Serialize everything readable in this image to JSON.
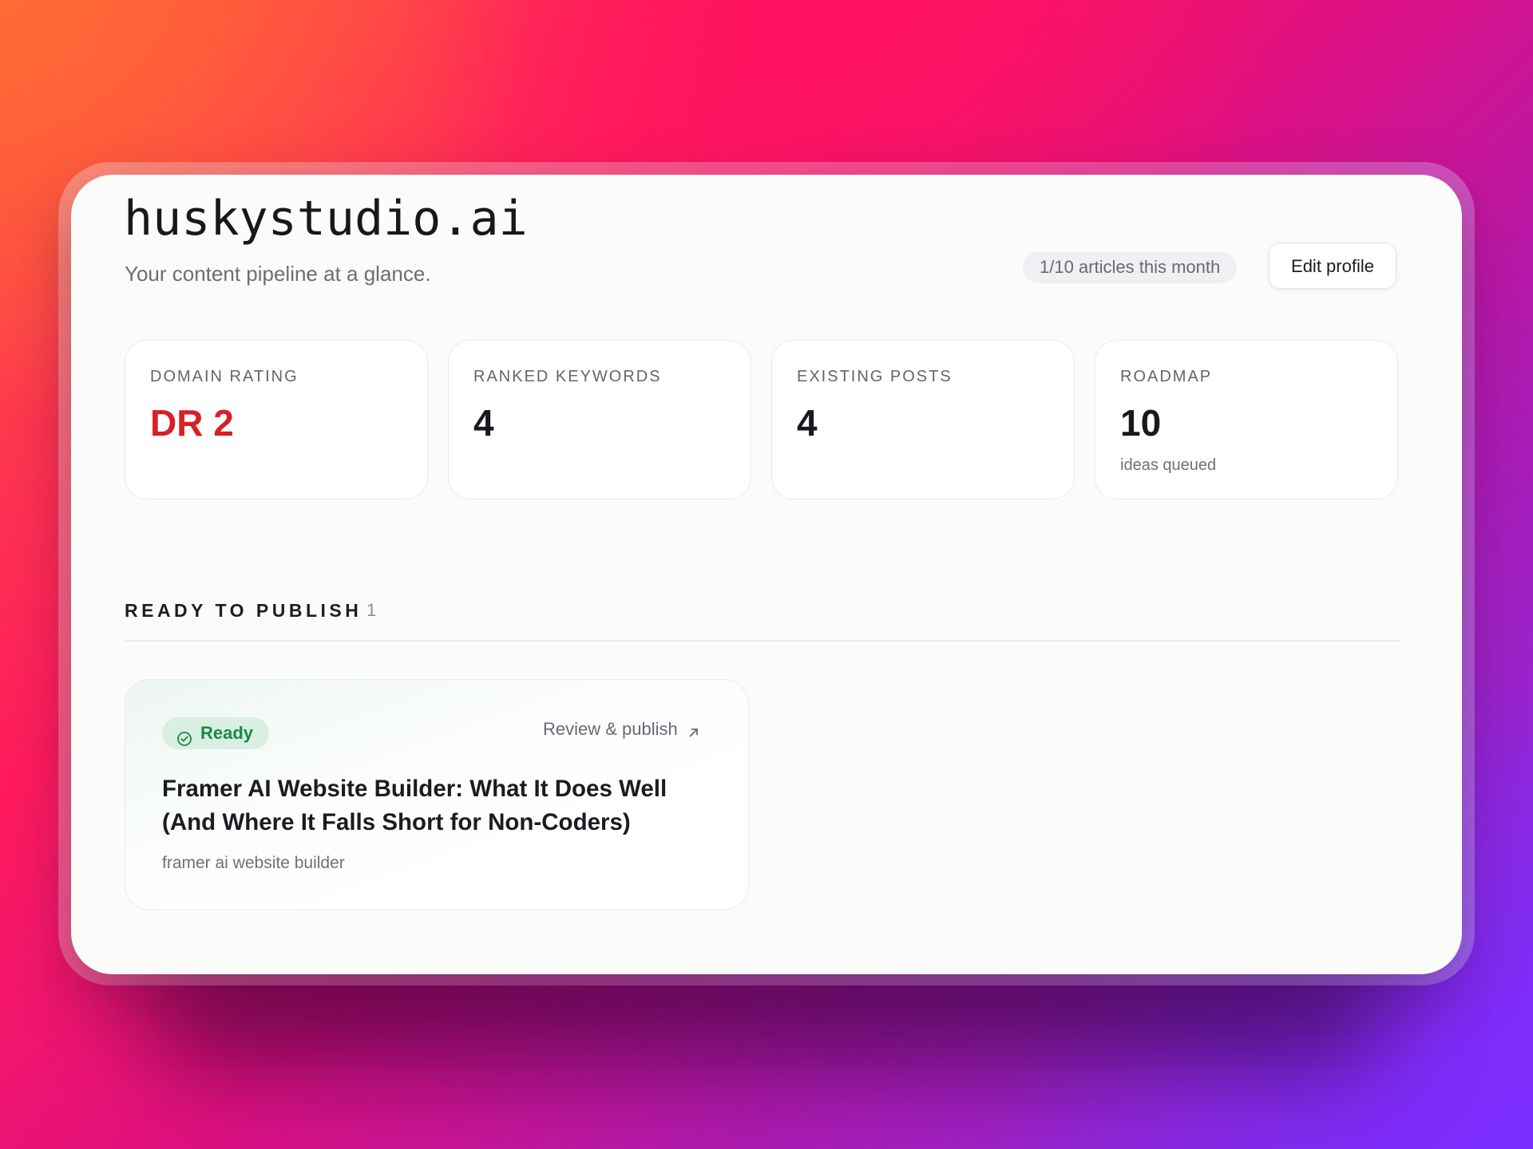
{
  "header": {
    "site_title": "huskystudio.ai",
    "subtitle": "Your content pipeline at a glance.",
    "usage": "1/10 articles this month",
    "edit_profile_label": "Edit profile"
  },
  "stats": [
    {
      "label": "DOMAIN RATING",
      "value": "DR 2",
      "note": ""
    },
    {
      "label": "RANKED KEYWORDS",
      "value": "4",
      "note": ""
    },
    {
      "label": "EXISTING POSTS",
      "value": "4",
      "note": ""
    },
    {
      "label": "ROADMAP",
      "value": "10",
      "note": "ideas queued"
    }
  ],
  "section": {
    "title": "READY TO PUBLISH",
    "count": "1"
  },
  "articles": [
    {
      "status": "Ready",
      "action": "Review & publish",
      "title": "Framer AI Website Builder: What It Does Well (And Where It Falls Short for Non-Coders)",
      "keyword": "framer ai website builder"
    }
  ],
  "colors": {
    "dr_value": "#d81f26",
    "ready_text": "#1a8a4a",
    "ready_bg": "#d8efe1"
  },
  "icons": {
    "ready": "check-circle-icon",
    "action": "arrow-up-right-icon"
  }
}
